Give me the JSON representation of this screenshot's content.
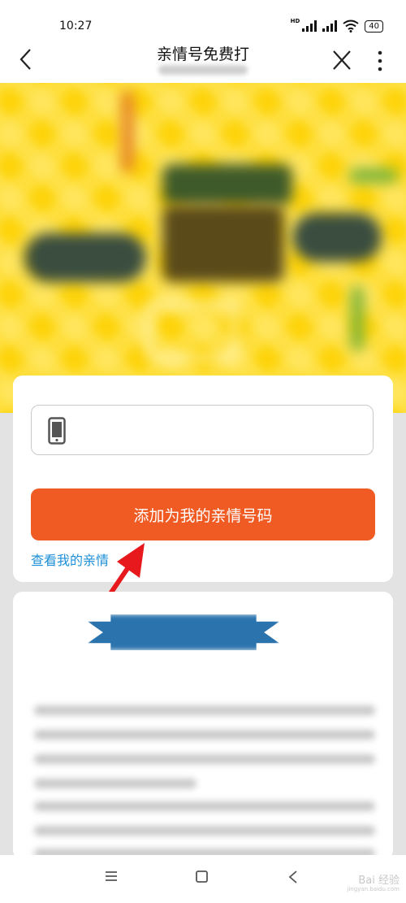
{
  "status_bar": {
    "time": "10:27",
    "network_badge": "HD",
    "battery": "40"
  },
  "nav": {
    "title": "亲情号免费打",
    "icons": [
      "back-arrow-icon",
      "close-icon",
      "more-vertical-icon"
    ]
  },
  "form": {
    "phone_icon": "mobile-phone-icon",
    "add_button_label": "添加为我的亲情号码",
    "view_link_label": "查看我的亲情"
  },
  "colors": {
    "banner_yellow": "#fdd40b",
    "primary_orange": "#f05a23",
    "link_blue": "#1d8fd8",
    "annotation_red": "#e8191c"
  },
  "bottom_nav": {
    "icons": [
      "menu-icon",
      "home-square-icon",
      "back-chevron-icon"
    ]
  },
  "watermark": {
    "text": "Bai 经验",
    "sub": "jingyan.baidu.com"
  }
}
